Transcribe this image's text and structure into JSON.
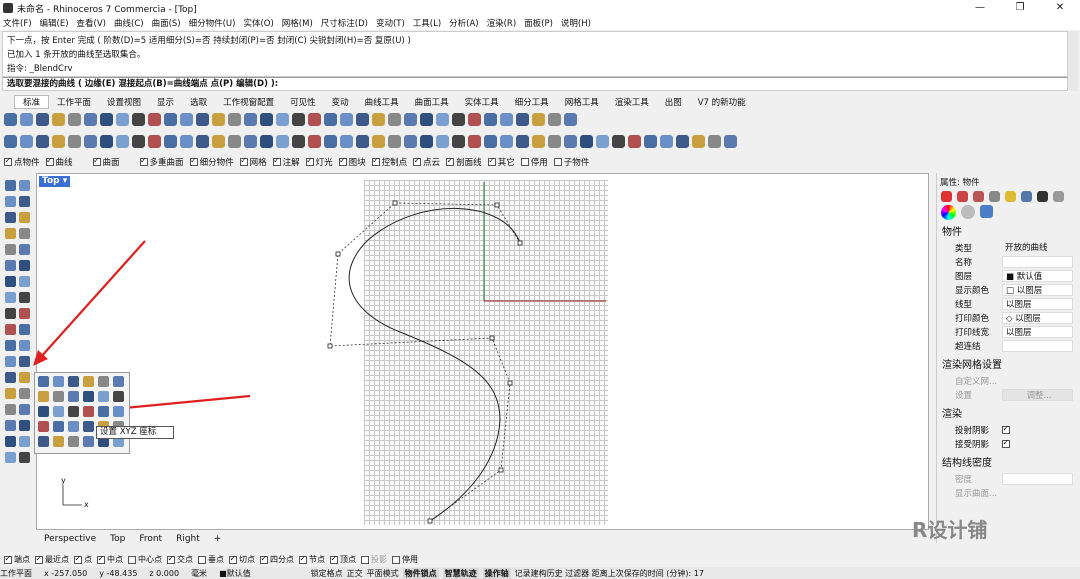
{
  "window": {
    "title": "未命名 - Rhinoceros 7 Commercia - [Top]",
    "buttons": [
      "—",
      "❐",
      "✕"
    ]
  },
  "menu": [
    "文件(F)",
    "编辑(E)",
    "查看(V)",
    "曲线(C)",
    "曲面(S)",
    "细分物件(U)",
    "实体(O)",
    "网格(M)",
    "尺寸标注(D)",
    "变动(T)",
    "工具(L)",
    "分析(A)",
    "渲染(R)",
    "面板(P)",
    "说明(H)"
  ],
  "command": {
    "history": [
      "下一点，按 Enter 完成 ( 阶数(D)=5  适用细分(S)=否  持续封闭(P)=否  封闭(C)  尖锐封闭(H)=否  复原(U) )",
      "已加入 1 条开放的曲线至选取集合。",
      "指令: _BlendCrv"
    ],
    "prompt": "选取要混接的曲线 ( 边缘(E)  混接起点(B)=曲线端点  点(P)  编辑(D) ):"
  },
  "toolbar_tabs": [
    "标准",
    "工作平面",
    "设置视图",
    "显示",
    "选取",
    "工作视窗配置",
    "可见性",
    "变动",
    "曲线工具",
    "曲面工具",
    "实体工具",
    "细分工具",
    "网格工具",
    "渲染工具",
    "出图",
    "V7 的新功能"
  ],
  "filters": [
    {
      "label": "点物件",
      "on": true
    },
    {
      "label": "曲线",
      "on": true
    },
    {
      "label": "曲面",
      "on": true
    },
    {
      "label": "多重曲面",
      "on": true
    },
    {
      "label": "细分物件",
      "on": true
    },
    {
      "label": "网格",
      "on": true
    },
    {
      "label": "注解",
      "on": true
    },
    {
      "label": "灯光",
      "on": true
    },
    {
      "label": "图块",
      "on": true
    },
    {
      "label": "控制点",
      "on": true
    },
    {
      "label": "点云",
      "on": true
    },
    {
      "label": "剖面线",
      "on": true
    },
    {
      "label": "其它",
      "on": true
    },
    {
      "label": "停用",
      "on": false
    },
    {
      "label": "子物件",
      "on": false
    }
  ],
  "viewport": {
    "name": "Top",
    "tabs": [
      "Perspective",
      "Top",
      "Front",
      "Right",
      "+"
    ],
    "axis_x": "x",
    "axis_y": "y"
  },
  "tooltip": "设置 XYZ 座标",
  "properties": {
    "title": "属性: 物件",
    "section_object": "物件",
    "rows": [
      {
        "k": "类型",
        "v": "开放的曲线"
      },
      {
        "k": "名称",
        "v": ""
      },
      {
        "k": "图层",
        "v": "■ 默认值"
      },
      {
        "k": "显示颜色",
        "v": "□ 以图层"
      },
      {
        "k": "线型",
        "v": "以图层"
      },
      {
        "k": "打印颜色",
        "v": "◇ 以图层"
      },
      {
        "k": "打印线宽",
        "v": "以图层"
      },
      {
        "k": "超连结",
        "v": ""
      }
    ],
    "section_render_mesh": "渲染网格设置",
    "custom_mesh": "自定义网...",
    "settings_label": "设置",
    "adjust_button": "调整...",
    "section_render": "渲染",
    "cast_shadows": "投射阴影",
    "receive_shadows": "接受阴影",
    "section_isocurve": "结构线密度",
    "density_label": "密度",
    "show_curves": "显示曲面..."
  },
  "osnap": [
    {
      "label": "端点",
      "on": true
    },
    {
      "label": "最近点",
      "on": true
    },
    {
      "label": "点",
      "on": true
    },
    {
      "label": "中点",
      "on": true
    },
    {
      "label": "中心点",
      "on": false
    },
    {
      "label": "交点",
      "on": true
    },
    {
      "label": "垂点",
      "on": false
    },
    {
      "label": "切点",
      "on": true
    },
    {
      "label": "四分点",
      "on": true
    },
    {
      "label": "节点",
      "on": true
    },
    {
      "label": "顶点",
      "on": true
    },
    {
      "label": "投影",
      "on": false
    },
    {
      "label": "停用",
      "on": false
    }
  ],
  "status": {
    "cplane": "工作平面",
    "x": "x -257.050",
    "y": "y -48.435",
    "z": "z 0.000",
    "unit": "毫米",
    "layer": "■默认值",
    "items": [
      "锁定格点",
      "正交",
      "平面模式"
    ],
    "bold_items": [
      "物件锁点",
      "智慧轨迹",
      "操作轴"
    ],
    "tail": "记录建构历史  过滤器  距离上次保存的时间 (分钟): 17"
  },
  "watermark": "R设计铺",
  "colors": {
    "accent": "#3b6fd6",
    "arrow": "#e02020",
    "grid": "#bfbfbf"
  }
}
